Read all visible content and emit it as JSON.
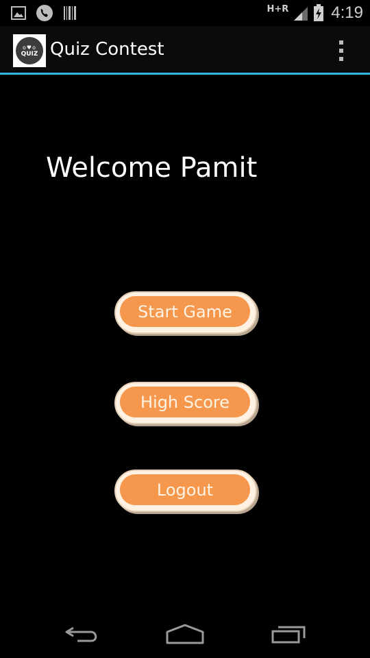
{
  "status_bar": {
    "left_icons": [
      "image-notification-icon",
      "phone-call-icon",
      "barcode-notification-icon"
    ],
    "network_type": "H+R",
    "signal_icon": "signal-strength-icon",
    "battery_icon": "battery-charging-icon",
    "time": "4:19"
  },
  "action_bar": {
    "app_icon": {
      "dots": "o♥o",
      "text": "QUIZ"
    },
    "title": "Quiz Contest",
    "overflow_icon": "overflow-menu-icon",
    "accent_color": "#33b5e5"
  },
  "main": {
    "welcome_text": "Welcome Pamit",
    "buttons": {
      "start_game": "Start Game",
      "high_score": "High Score",
      "logout": "Logout"
    },
    "button_color": "#f5974c"
  },
  "nav_bar": {
    "back_icon": "back-icon",
    "home_icon": "home-icon",
    "recents_icon": "recent-apps-icon"
  }
}
